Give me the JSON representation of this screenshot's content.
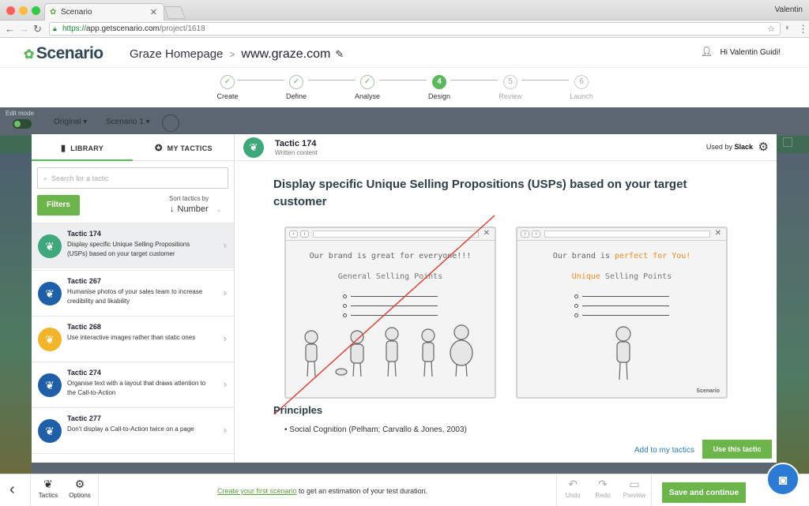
{
  "browser": {
    "tab_title": "Scenario",
    "profile_name": "Valentin",
    "url_scheme": "https://",
    "url_host": "app.getscenario.com",
    "url_path": "/project/1618"
  },
  "header": {
    "logo_text": "Scenario",
    "project_name": "Graze Homepage",
    "separator": ">",
    "domain": "www.graze.com",
    "greeting": "Hi Valentin Guidi!"
  },
  "steps": [
    {
      "num": "✓",
      "label": "Create"
    },
    {
      "num": "✓",
      "label": "Define"
    },
    {
      "num": "✓",
      "label": "Analyse"
    },
    {
      "num": "4",
      "label": "Design"
    },
    {
      "num": "5",
      "label": "Review"
    },
    {
      "num": "6",
      "label": "Launch"
    }
  ],
  "background": {
    "edit_mode": "Edit mode",
    "menu1": "Original ▾",
    "menu2": "Scenario 1 ▾"
  },
  "library": {
    "tab_library": "LIBRARY",
    "tab_my_tactics": "MY TACTICS",
    "search_placeholder": "Search for a tactic",
    "filters_label": "Filters",
    "sort_label": "Sort tactics by",
    "sort_value": "Number",
    "items": [
      {
        "title": "Tactic 174",
        "desc": "Display specific Unique Selling Propositions (USPs) based on your target customer",
        "color": "#3fa77c"
      },
      {
        "title": "Tactic 267",
        "desc": "Humanise photos of your sales team to increase credibility and likability",
        "color": "#1f5fa8"
      },
      {
        "title": "Tactic 268",
        "desc": "Use interactive images rather than static ones",
        "color": "#f2b52a"
      },
      {
        "title": "Tactic 274",
        "desc": "Organise text with a layout that draws attention to the Call-to-Action",
        "color": "#1f5fa8"
      },
      {
        "title": "Tactic 277",
        "desc": "Don't display a Call-to-Action twice on a page",
        "color": "#1f5fa8"
      }
    ]
  },
  "detail": {
    "tactic_title": "Tactic 174",
    "tactic_category": "Written content",
    "used_by_label": "Used by",
    "used_by_value": "Slack",
    "headline": "Display specific Unique Selling Propositions (USPs) based on your target customer",
    "illustration_left": {
      "line1": "Our brand is great for everyone!!!",
      "line2": "General Selling Points"
    },
    "illustration_right": {
      "line1_pre": "Our brand is ",
      "line1_hl": "perfect for You!",
      "line2_hl": "Unique",
      "line2_post": " Selling Points",
      "logo": "Scenario"
    },
    "principles_title": "Principles",
    "principles": [
      "Social Cognition (Pelham; Carvallo & Jones, 2003)"
    ],
    "add_link": "Add to my tactics",
    "use_button": "Use this tactic"
  },
  "bottom": {
    "tactics_label": "Tactics",
    "options_label": "Options",
    "message_link": "Create your first scenario",
    "message_rest": " to get an estimation of your test duration.",
    "undo_label": "Undo",
    "redo_label": "Redo",
    "preview_label": "Preview",
    "save_label": "Save and continue"
  }
}
